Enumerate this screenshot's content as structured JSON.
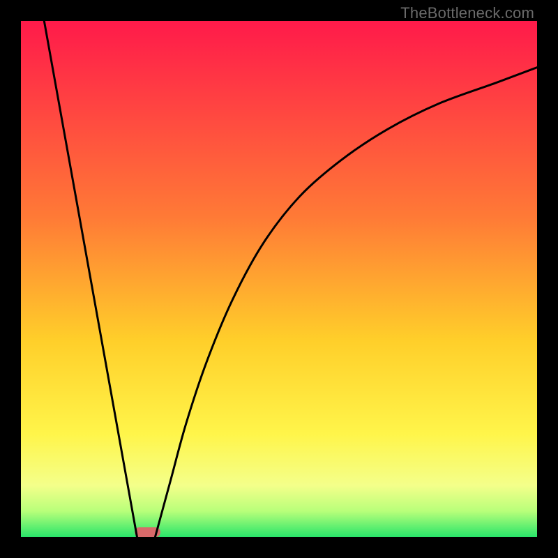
{
  "watermark": "TheBottleneck.com",
  "chart_data": {
    "type": "line",
    "title": "",
    "xlabel": "",
    "ylabel": "",
    "xlim": [
      0,
      100
    ],
    "ylim": [
      0,
      100
    ],
    "gradient_stops": [
      {
        "offset": 0,
        "color": "#ff1a4a"
      },
      {
        "offset": 38,
        "color": "#ff7a36"
      },
      {
        "offset": 62,
        "color": "#ffcf2a"
      },
      {
        "offset": 80,
        "color": "#fff54a"
      },
      {
        "offset": 90,
        "color": "#f4ff8a"
      },
      {
        "offset": 95,
        "color": "#b8ff7a"
      },
      {
        "offset": 100,
        "color": "#28e56a"
      }
    ],
    "series": [
      {
        "name": "left-line",
        "x": [
          4.5,
          22.5
        ],
        "y": [
          100,
          0
        ]
      },
      {
        "name": "right-curve",
        "x": [
          26,
          29,
          32,
          36,
          41,
          47,
          54,
          62,
          71,
          81,
          92,
          100
        ],
        "y": [
          0,
          11,
          22,
          34,
          46,
          57,
          66,
          73,
          79,
          84,
          88,
          91
        ]
      }
    ],
    "marker": {
      "x_center": 24.5,
      "y": 0,
      "width_pct": 5,
      "color": "#d86a6a"
    }
  }
}
